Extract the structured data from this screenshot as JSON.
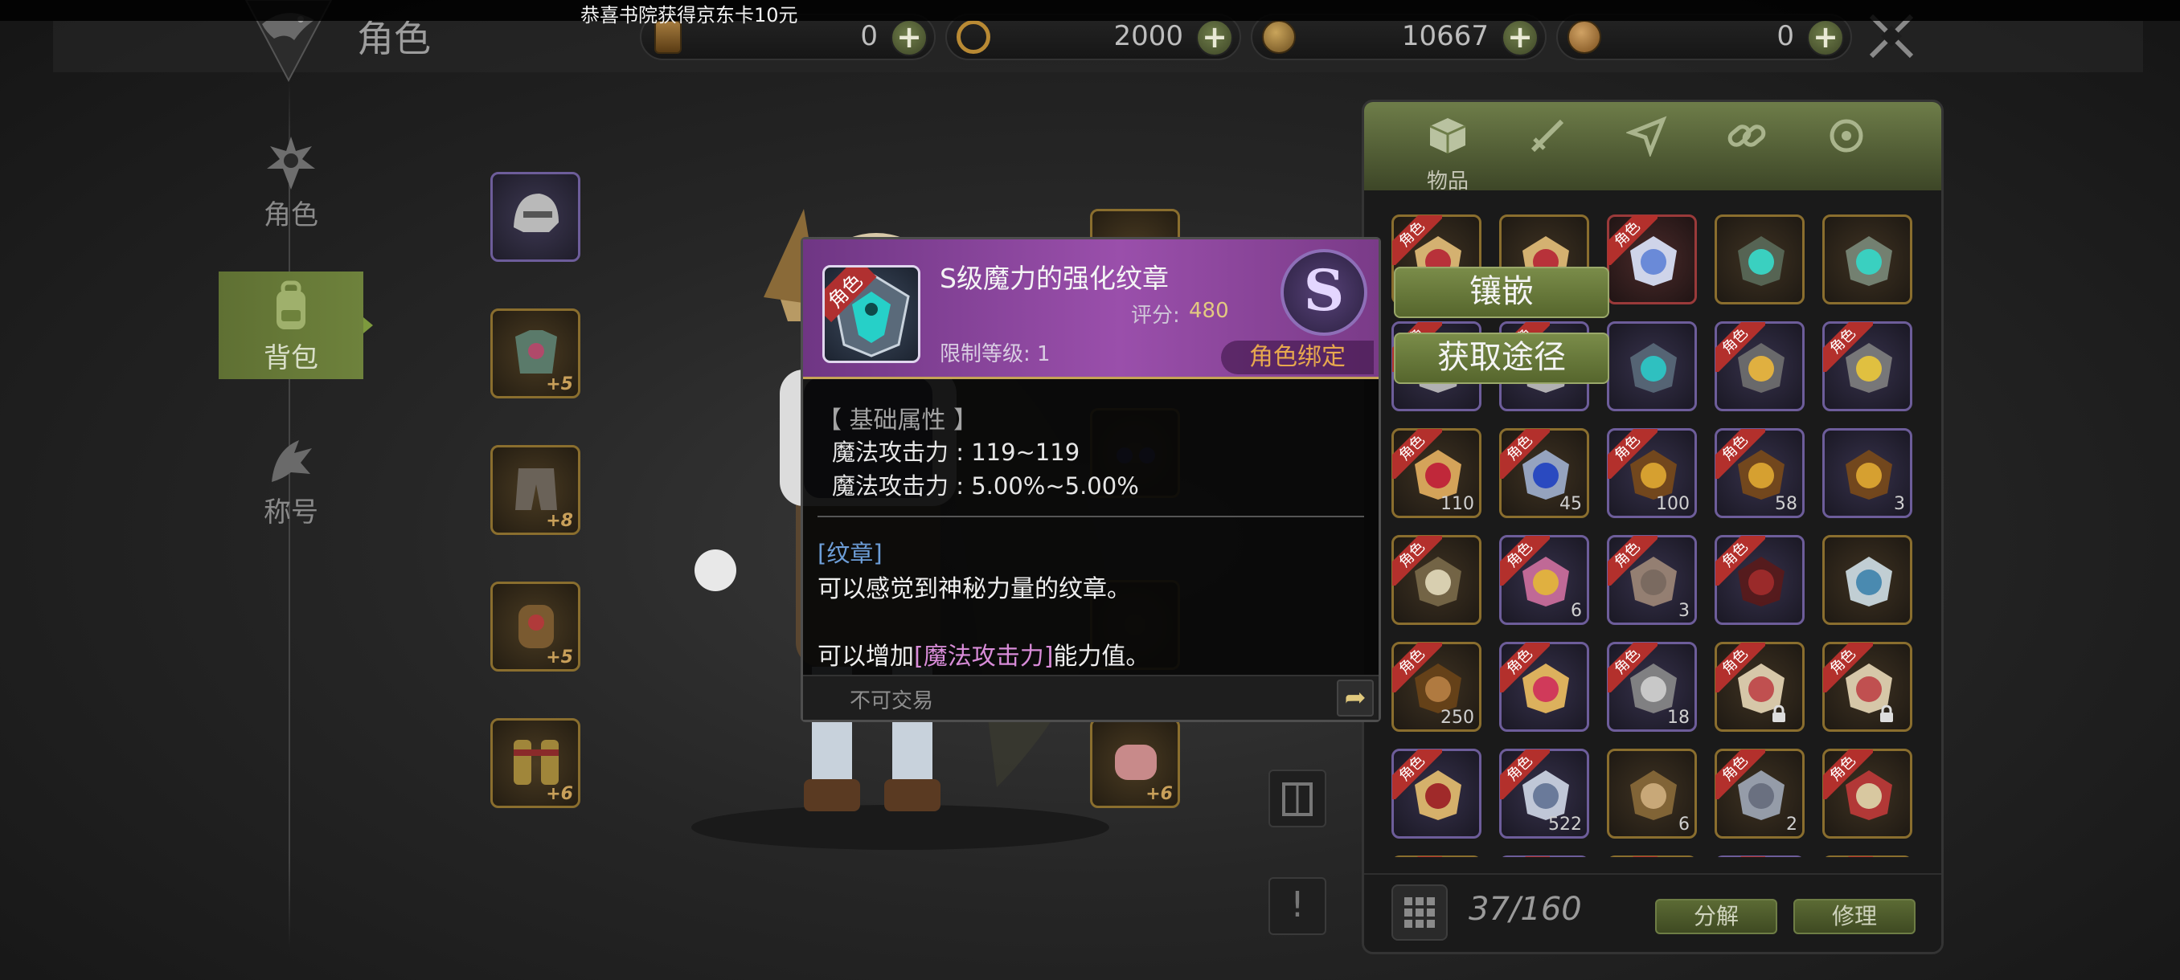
{
  "notification": "恭喜书院获得京东卡10元",
  "header": {
    "title": "角色",
    "currencies": [
      {
        "icon": "ticket-card-icon",
        "value": "0"
      },
      {
        "icon": "swirl-coin-icon",
        "value": "2000"
      },
      {
        "icon": "gold-coin-icon",
        "value": "10667"
      },
      {
        "icon": "bronze-coin-icon",
        "value": "0"
      }
    ],
    "plus_label": "+",
    "close_icon": "crossed-swords-close-icon"
  },
  "sidebar": {
    "items": [
      {
        "label": "角色",
        "icon": "character-icon"
      },
      {
        "label": "背包",
        "icon": "backpack-icon"
      },
      {
        "label": "称号",
        "icon": "title-dragon-icon"
      }
    ],
    "active": "背包"
  },
  "equipment": {
    "left": [
      {
        "enhance": ""
      },
      {
        "enhance": "+5"
      },
      {
        "enhance": "+8"
      },
      {
        "enhance": "+5"
      },
      {
        "enhance": "+6"
      }
    ],
    "right_bottom_enhance": "+6"
  },
  "tooltip": {
    "ribbon": "角色",
    "name": "S级魔力的强化纹章",
    "score_label": "评分:",
    "score": "480",
    "level": "限制等级: 1",
    "grade": "S",
    "bind": "角色绑定",
    "attr_title": "【 基础属性 】",
    "attrs": [
      "魔法攻击力 : 119~119",
      "魔法攻击力 : 5.00%~5.00%"
    ],
    "category": "[纹章]",
    "desc1": "可以感觉到神秘力量的纹章。",
    "desc2_pre": "可以增加",
    "desc2_hl": "[魔法攻击力]",
    "desc2_post": "能力值。",
    "trade": "不可交易"
  },
  "actions": {
    "inlay": "镶嵌",
    "source": "获取途径"
  },
  "inventory": {
    "tab_label": "物品",
    "tabs": [
      "items-box-icon",
      "sword-icon",
      "glider-icon",
      "chain-link-icon",
      "gear-orb-icon"
    ],
    "ribbon": "角色",
    "cells": [
      {
        "tier": "gold",
        "badge": true,
        "count": "",
        "art": "red-book"
      },
      {
        "tier": "gold",
        "badge": false,
        "count": "",
        "art": "red-book"
      },
      {
        "tier": "red",
        "badge": true,
        "count": "",
        "art": "compass-star"
      },
      {
        "tier": "gold",
        "badge": false,
        "count": "",
        "art": "teal-shield"
      },
      {
        "tier": "gold",
        "badge": false,
        "count": "",
        "art": "teal-heart"
      },
      {
        "tier": "purple",
        "badge": true,
        "count": "",
        "art": "gray-emblem"
      },
      {
        "tier": "purple",
        "badge": true,
        "count": "",
        "art": "gray-emblem"
      },
      {
        "tier": "purple",
        "badge": false,
        "count": "",
        "art": "teal-emblem"
      },
      {
        "tier": "purple",
        "badge": true,
        "count": "",
        "art": "swirl-emblem"
      },
      {
        "tier": "purple",
        "badge": true,
        "count": "",
        "art": "gold-emblem"
      },
      {
        "tier": "gold",
        "badge": true,
        "count": "110",
        "art": "red-potion"
      },
      {
        "tier": "gold",
        "badge": true,
        "count": "45",
        "art": "blue-potion"
      },
      {
        "tier": "purple",
        "badge": true,
        "count": "100",
        "art": "gold-bug"
      },
      {
        "tier": "purple",
        "badge": true,
        "count": "58",
        "art": "gold-bug"
      },
      {
        "tier": "purple",
        "badge": false,
        "count": "3",
        "art": "gold-bug"
      },
      {
        "tier": "gold",
        "badge": true,
        "count": "",
        "art": "bone-claw"
      },
      {
        "tier": "purple",
        "badge": true,
        "count": "6",
        "art": "gold-ring"
      },
      {
        "tier": "purple",
        "badge": true,
        "count": "3",
        "art": "rock-pile"
      },
      {
        "tier": "purple",
        "badge": true,
        "count": "",
        "art": "red-vine"
      },
      {
        "tier": "gold",
        "badge": false,
        "count": "",
        "art": "teal-pot"
      },
      {
        "tier": "gold",
        "badge": true,
        "count": "250",
        "art": "bronze-coin"
      },
      {
        "tier": "purple",
        "badge": true,
        "count": "",
        "art": "magic-book"
      },
      {
        "tier": "purple",
        "badge": true,
        "count": "18",
        "art": "gray-orb"
      },
      {
        "tier": "gold",
        "badge": true,
        "count": "",
        "art": "card-locked"
      },
      {
        "tier": "gold",
        "badge": true,
        "count": "",
        "art": "card-locked"
      },
      {
        "tier": "purple",
        "badge": true,
        "count": "",
        "art": "red-chest"
      },
      {
        "tier": "purple",
        "badge": true,
        "count": "522",
        "art": "dragon-coin"
      },
      {
        "tier": "gold",
        "badge": false,
        "count": "6",
        "art": "scroll"
      },
      {
        "tier": "gold",
        "badge": true,
        "count": "2",
        "art": "stone-golem"
      },
      {
        "tier": "gold",
        "badge": true,
        "count": "",
        "art": "mask-map"
      }
    ],
    "capacity": "37/160",
    "decompose": "分解",
    "repair": "修理"
  },
  "colors": {
    "accent_green": "#6e823c",
    "tooltip_purple": "#9a4fab",
    "gold": "#c6a356"
  }
}
